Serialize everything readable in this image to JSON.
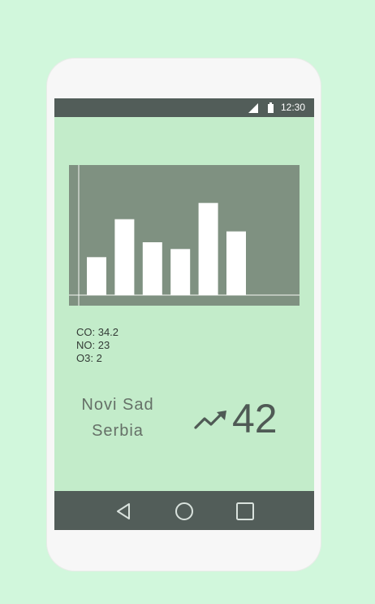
{
  "status_bar": {
    "time": "12:30",
    "icons": [
      "signal-icon",
      "battery-icon"
    ]
  },
  "chart_data": {
    "type": "bar",
    "categories": [
      "",
      "",
      "",
      "",
      "",
      ""
    ],
    "values": [
      28,
      56,
      39,
      34,
      68,
      47
    ],
    "ylim": [
      0,
      90
    ],
    "grid": false,
    "colors": {
      "background": "#7f9181",
      "bars": "#ffffff",
      "axes": "#f4f7f4"
    }
  },
  "readings": {
    "co": "CO: 34.2",
    "no": "NO: 23",
    "o3": "O3: 2"
  },
  "location": {
    "city": "Novi Sad",
    "country": "Serbia"
  },
  "aqi": {
    "value": "42",
    "trend_icon": "trending-up-icon"
  },
  "navigation": {
    "icons": [
      "back-icon",
      "home-icon",
      "recents-icon"
    ]
  },
  "colors": {
    "background": "#d1f7dc",
    "screen": "#c3ecca",
    "bars": "#525d59"
  }
}
